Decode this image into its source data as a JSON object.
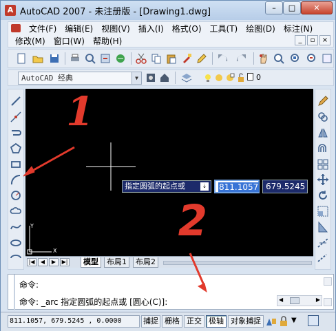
{
  "window": {
    "title": "AutoCAD 2007 - 未注册版 - [Drawing1.dwg]",
    "app_icon": "A",
    "minimize": "–",
    "maximize": "□",
    "close": "✕"
  },
  "menu": {
    "row1": [
      "文件(F)",
      "编辑(E)",
      "视图(V)",
      "插入(I)",
      "格式(O)",
      "工具(T)",
      "绘图(D)",
      "标注(N)"
    ],
    "row2": [
      "修改(M)",
      "窗口(W)",
      "帮助(H)"
    ],
    "mdi_min": "_",
    "mdi_max": "▫",
    "mdi_close": "×"
  },
  "workspace": {
    "value": "AutoCAD 经典",
    "dropdown_glyph": "▼"
  },
  "layer": {
    "value": "0"
  },
  "tabs": {
    "model": "模型",
    "layout1": "布局1",
    "layout2": "布局2",
    "nav": [
      "|◀",
      "◀",
      "▶",
      "▶|"
    ]
  },
  "ucs": {
    "x_label": "X",
    "y_label": "Y"
  },
  "dynamic_input": {
    "prompt": "指定圆弧的起点或",
    "prompt_icon": "⇣",
    "x_value": "811.1057",
    "y_value": "679.5245"
  },
  "command": {
    "line1": "命令:",
    "line2": "命令: _arc 指定圆弧的起点或 [圆心(C)]:",
    "scroll_left": "◀",
    "scroll_right": "▶"
  },
  "status": {
    "coords": "811.1057,  679.5245 , 0.0000",
    "buttons": [
      "捕捉",
      "栅格",
      "正交",
      "极轴",
      "对象捕捉"
    ]
  },
  "annotations": {
    "label1": "1",
    "label2": "2",
    "color": "#e23a2c"
  },
  "colors": {
    "canvas": "#000000",
    "dyn_bg": "#1c2a6a",
    "dyn_highlight": "#3874d6"
  }
}
